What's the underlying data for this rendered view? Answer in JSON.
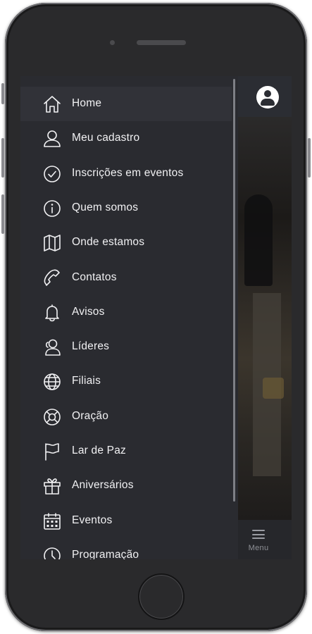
{
  "drawer": {
    "items": [
      {
        "label": "Home",
        "icon": "home-icon",
        "active": true
      },
      {
        "label": "Meu cadastro",
        "icon": "user-icon"
      },
      {
        "label": "Inscrições em eventos",
        "icon": "check-circle-icon"
      },
      {
        "label": "Quem somos",
        "icon": "info-icon"
      },
      {
        "label": "Onde estamos",
        "icon": "map-icon"
      },
      {
        "label": "Contatos",
        "icon": "phone-icon"
      },
      {
        "label": "Avisos",
        "icon": "bell-icon"
      },
      {
        "label": "Líderes",
        "icon": "leaders-icon"
      },
      {
        "label": "Filiais",
        "icon": "globe-icon"
      },
      {
        "label": "Oração",
        "icon": "lifebuoy-icon"
      },
      {
        "label": "Lar de Paz",
        "icon": "flag-icon"
      },
      {
        "label": "Aniversários",
        "icon": "gift-icon"
      },
      {
        "label": "Eventos",
        "icon": "calendar-icon"
      },
      {
        "label": "Programação",
        "icon": "clock-icon"
      }
    ]
  },
  "bottom_nav": {
    "menu_label": "Menu"
  },
  "colors": {
    "drawer_bg": "#2a2b30",
    "header_bg": "#2b2d33",
    "text": "#f1f1f3"
  }
}
